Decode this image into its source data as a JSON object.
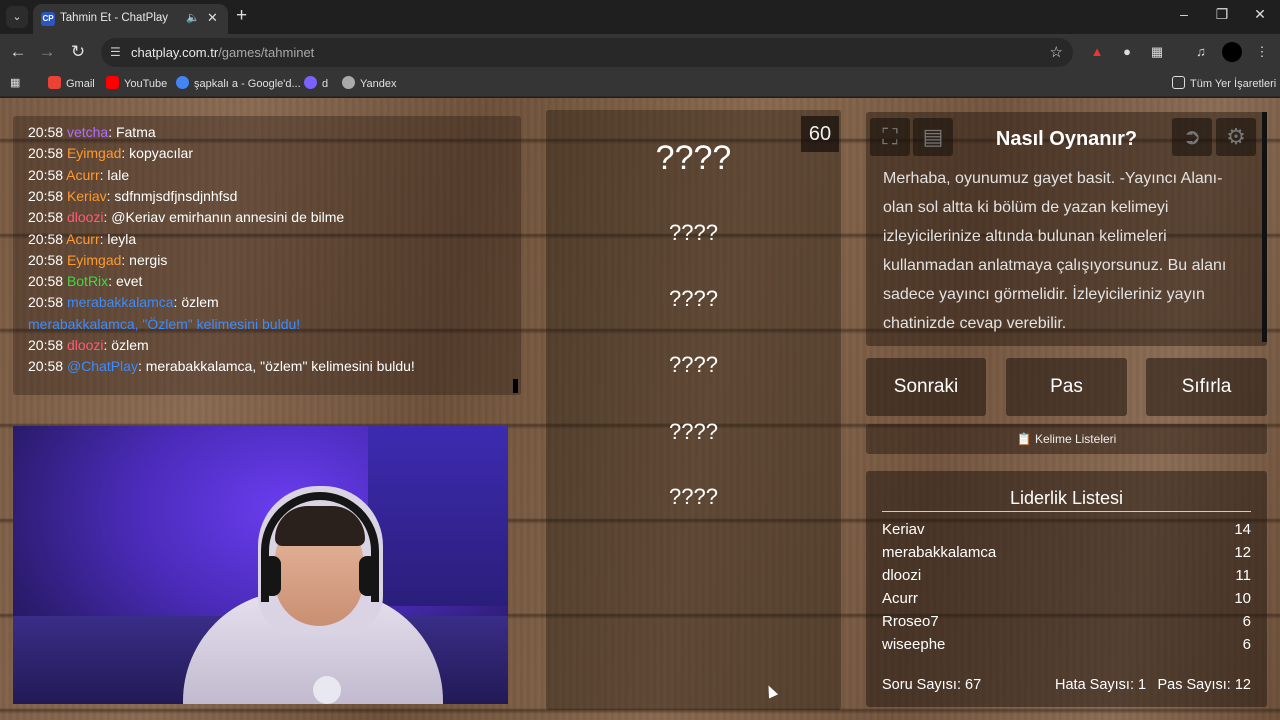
{
  "browser": {
    "tab_title": "Tahmin Et - ChatPlay",
    "tab_favicon": "CP",
    "url_host": "chatplay.com.tr",
    "url_path": "/games/tahminet",
    "bookmarks": [
      {
        "label": "Gmail",
        "color": "#ea4335"
      },
      {
        "label": "YouTube",
        "color": "#ff0000"
      },
      {
        "label": "şapkalı a - Google'd...",
        "color": "#4285f4"
      },
      {
        "label": "d",
        "color": "#7b61ff"
      },
      {
        "label": "Yandex",
        "color": "#aaaaaa"
      }
    ],
    "all_bookmarks": "Tüm Yer İşaretleri"
  },
  "chat": {
    "messages": [
      {
        "time": "20:58",
        "user": "vetcha",
        "color": "#b26bff",
        "text": ": Fatma"
      },
      {
        "time": "20:58",
        "user": "Eyimgad",
        "color": "#ff9a2e",
        "text": ": kopyacılar"
      },
      {
        "time": "20:58",
        "user": "Acurr",
        "color": "#ff9a2e",
        "text": ": lale"
      },
      {
        "time": "20:58",
        "user": "Keriav",
        "color": "#ff9a2e",
        "text": ": sdfnmjsdfjnsdjnhfsd"
      },
      {
        "time": "20:58",
        "user": "dloozi",
        "color": "#ff5a7a",
        "text": ": @Keriav emirhanın annesini de bilme"
      },
      {
        "time": "20:58",
        "user": "Acurr",
        "color": "#ff9a2e",
        "text": ": leyla"
      },
      {
        "time": "20:58",
        "user": "Eyimgad",
        "color": "#ff9a2e",
        "text": ": nergis"
      },
      {
        "time": "20:58",
        "user": "BotRix",
        "color": "#3ddc3d",
        "text": ": evet"
      },
      {
        "time": "20:58",
        "user": "merabakkalamca",
        "color": "#3b8cff",
        "text": ": özlem"
      },
      {
        "system": "merabakkalamca, \"Özlem\" kelimesini buldu!"
      },
      {
        "time": "20:58",
        "user": "dloozi",
        "color": "#ff5a7a",
        "text": ": özlem"
      },
      {
        "time": "20:58",
        "user": "@ChatPlay",
        "color": "#3b8cff",
        "text": ": merabakkalamca, \"özlem\" kelimesini buldu!"
      }
    ]
  },
  "game": {
    "timer": "60",
    "words": [
      "????",
      "????",
      "????",
      "????",
      "????",
      "????"
    ]
  },
  "howto": {
    "title": "Nasıl Oynanır?",
    "text": "Merhaba, oyunumuz gayet basit. -Yayıncı Alanı- olan sol altta ki bölüm de yazan kelimeyi izleyicilerinize altında bulunan kelimeleri kullanmadan anlatmaya çalışıyorsunuz. Bu alanı sadece yayıncı görmelidir. İzleyicileriniz yayın chatinizde cevap verebilir."
  },
  "actions": {
    "next": "Sonraki",
    "pass": "Pas",
    "reset": "Sıfırla",
    "word_lists": "Kelime Listeleri"
  },
  "leaderboard": {
    "title": "Liderlik Listesi",
    "rows": [
      {
        "name": "Keriav",
        "score": "14"
      },
      {
        "name": "merabakkalamca",
        "score": "12"
      },
      {
        "name": "dloozi",
        "score": "11"
      },
      {
        "name": "Acurr",
        "score": "10"
      },
      {
        "name": "Rroseo7",
        "score": "6"
      },
      {
        "name": "wiseephe",
        "score": "6"
      }
    ],
    "questions": "Soru Sayısı: 67",
    "errors": "Hata Sayısı: 1",
    "passes": "Pas Sayısı: 12"
  }
}
